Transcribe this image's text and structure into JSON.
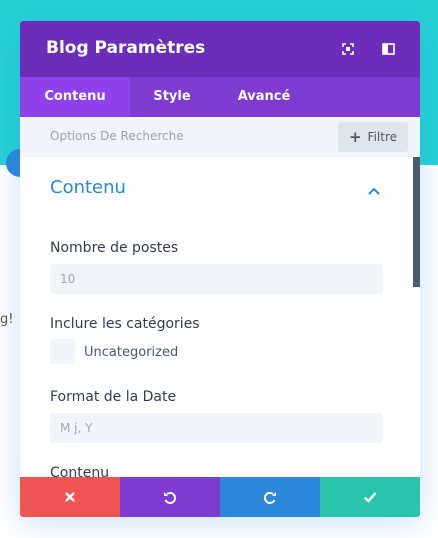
{
  "modal": {
    "title": "Blog Paramètres",
    "header_icons": [
      "fullscreen-icon",
      "split-view-icon"
    ]
  },
  "tabs": [
    {
      "label": "Contenu",
      "active": true
    },
    {
      "label": "Style",
      "active": false
    },
    {
      "label": "Avancé",
      "active": false
    }
  ],
  "search": {
    "label": "Options De Recherche",
    "filter_label": "Filtre"
  },
  "section": {
    "title": "Contenu",
    "expanded": true
  },
  "fields": {
    "posts_count": {
      "label": "Nombre de postes",
      "value": "10"
    },
    "categories": {
      "label": "Inclure les catégories",
      "option_label": "Uncategorized",
      "checked": false
    },
    "date_format": {
      "label": "Format de la Date",
      "placeholder": "M j, Y"
    },
    "content": {
      "label": "Contenu"
    }
  },
  "background": {
    "partial_text": "g!"
  },
  "footer": {
    "buttons": [
      "close-icon",
      "undo-icon",
      "redo-icon",
      "check-icon"
    ]
  },
  "colors": {
    "header": "#6c2eb9",
    "tabs": "#7e3bd0",
    "active_tab": "#8f42ec",
    "accent_blue": "#2b87da",
    "cancel": "#ef5555",
    "save": "#29c4a9",
    "background_teal": "#26d2d4"
  }
}
